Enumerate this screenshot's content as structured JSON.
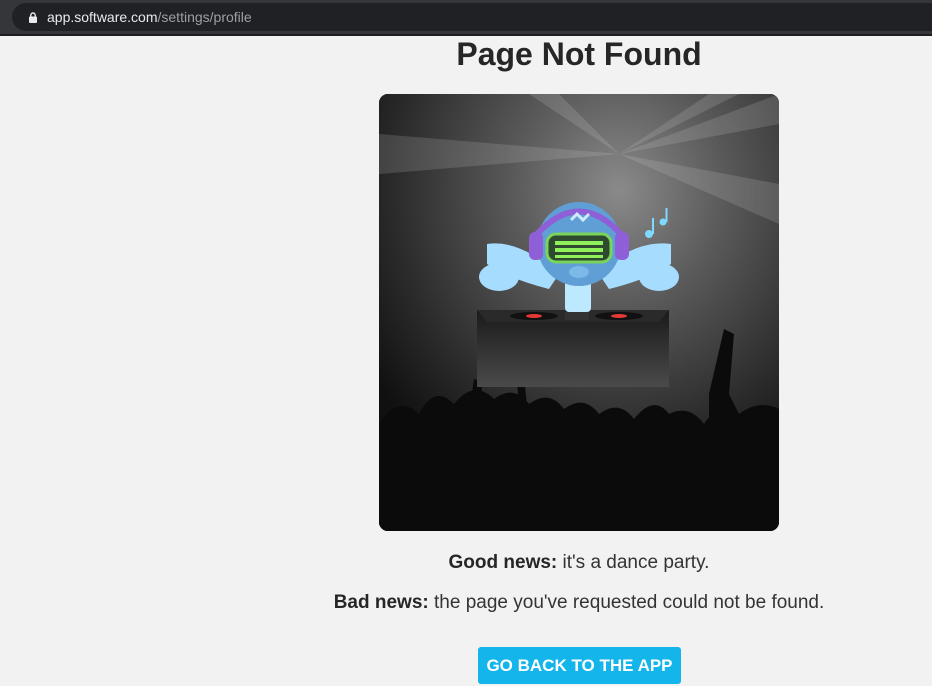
{
  "browser": {
    "url_host": "app.software.com",
    "url_path": "/settings/profile",
    "lock_icon": "lock-icon"
  },
  "page": {
    "title": "Page Not Found",
    "good_news_label": "Good news:",
    "good_news_text": " it's a dance party.",
    "bad_news_label": "Bad news:",
    "bad_news_text": " the page you've requested could not be found.",
    "cta_label": "GO BACK TO THE APP"
  },
  "illustration": {
    "subject": "dj-robot-icon",
    "note_icon": "music-note-icon"
  },
  "colors": {
    "accent": "#13b5ea",
    "page_background": "#f2f2f2",
    "title_text": "#262626"
  }
}
